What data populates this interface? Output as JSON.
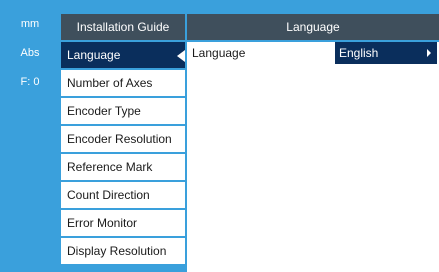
{
  "status_panel": {
    "items": [
      "mm",
      "Abs",
      "F:  0"
    ]
  },
  "menu": {
    "header": "Installation Guide",
    "items": [
      {
        "label": "Language",
        "selected": true
      },
      {
        "label": "Number of Axes",
        "selected": false
      },
      {
        "label": "Encoder Type",
        "selected": false
      },
      {
        "label": "Encoder Resolution",
        "selected": false
      },
      {
        "label": "Reference Mark",
        "selected": false
      },
      {
        "label": "Count Direction",
        "selected": false
      },
      {
        "label": "Error Monitor",
        "selected": false
      },
      {
        "label": "Display Resolution",
        "selected": false
      }
    ]
  },
  "detail": {
    "header": "Language",
    "language_label": "Language",
    "language_value": "English"
  },
  "colors": {
    "background": "#3aa0dc",
    "header": "#3f4f5c",
    "selected": "#0a2e5c",
    "panel": "#ffffff"
  }
}
